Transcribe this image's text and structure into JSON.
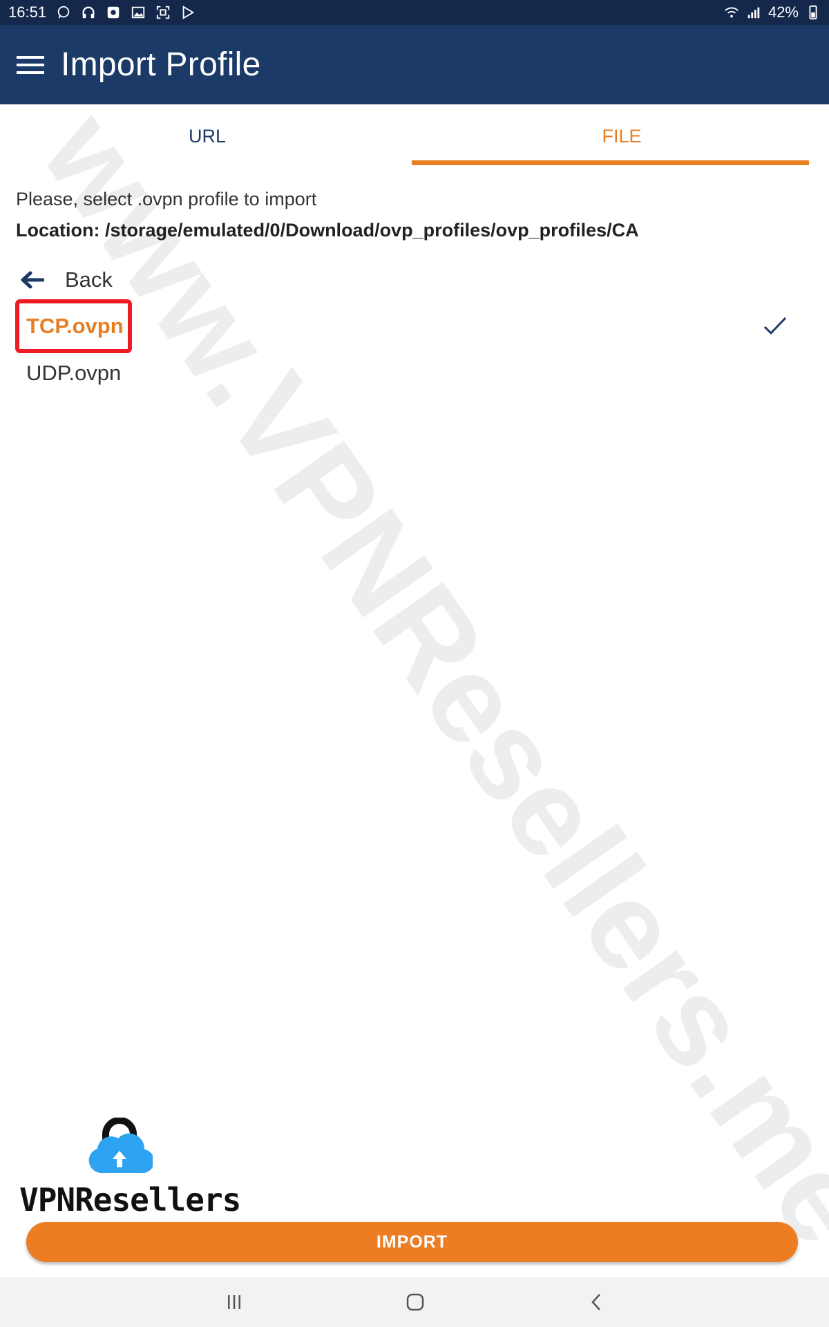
{
  "status_bar": {
    "time": "16:51",
    "battery": "42%",
    "left_icons": [
      "whatsapp-icon",
      "headphones-icon",
      "app-notification-icon",
      "image-icon",
      "screenshot-icon",
      "play-store-icon"
    ],
    "right_icons": [
      "wifi-icon",
      "signal-icon",
      "battery-icon"
    ]
  },
  "app_bar": {
    "title": "Import Profile",
    "menu_icon": "hamburger-menu-icon"
  },
  "tabs": [
    {
      "label": "URL",
      "active": false
    },
    {
      "label": "FILE",
      "active": true
    }
  ],
  "content": {
    "prompt": "Please, select .ovpn profile to import",
    "location": "Location: /storage/emulated/0/Download/ovp_profiles/ovp_profiles/CA",
    "back_label": "Back",
    "files": [
      {
        "name": "TCP.ovpn",
        "selected": true
      },
      {
        "name": "UDP.ovpn",
        "selected": false
      }
    ]
  },
  "watermark": "www.VPNResellers.me",
  "logo": {
    "text": "VPNResellers"
  },
  "import_button": {
    "label": "IMPORT"
  },
  "colors": {
    "status_bar": "#14284b",
    "app_bar": "#1b3a68",
    "accent": "#e67e22",
    "button": "#ec7d23",
    "highlight": "#ef1c24",
    "cloud": "#2ea3f2"
  }
}
